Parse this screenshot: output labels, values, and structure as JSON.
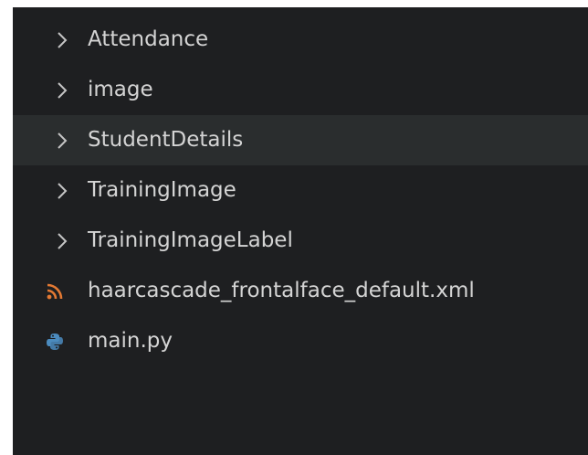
{
  "explorer": {
    "items": [
      {
        "kind": "folder",
        "label": "Attendance",
        "icon": "chevron-right-icon",
        "hovered": false
      },
      {
        "kind": "folder",
        "label": "image",
        "icon": "chevron-right-icon",
        "hovered": false
      },
      {
        "kind": "folder",
        "label": "StudentDetails",
        "icon": "chevron-right-icon",
        "hovered": true
      },
      {
        "kind": "folder",
        "label": "TrainingImage",
        "icon": "chevron-right-icon",
        "hovered": false
      },
      {
        "kind": "folder",
        "label": "TrainingImageLabel",
        "icon": "chevron-right-icon",
        "hovered": false
      },
      {
        "kind": "file",
        "label": "haarcascade_frontalface_default.xml",
        "icon": "rss-xml-file-icon",
        "icon_color": "#e37933"
      },
      {
        "kind": "file",
        "label": "main.py",
        "icon": "python-file-icon",
        "icon_color": "#4b8bbe"
      }
    ]
  },
  "colors": {
    "background": "#1e1f21",
    "hover_row": "#2a2d2e",
    "text": "#d4d4d4",
    "chevron": "#c5c5c5"
  }
}
